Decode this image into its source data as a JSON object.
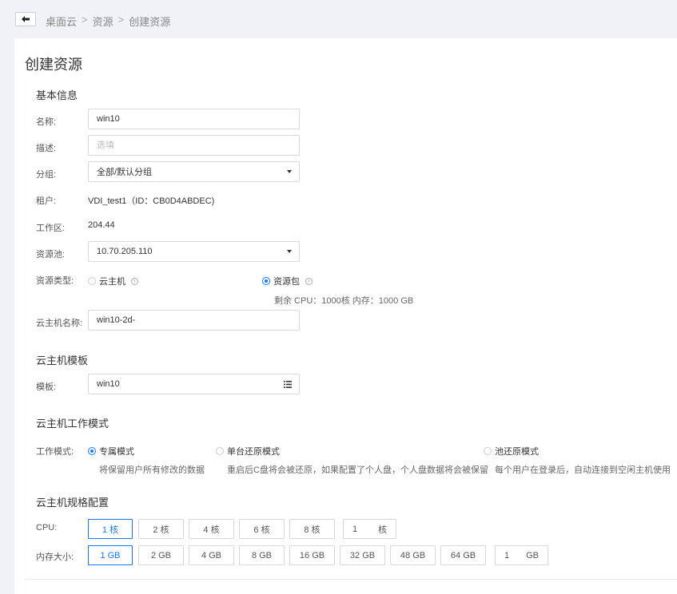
{
  "breadcrumb": {
    "items": [
      "桌面云",
      "资源",
      "创建资源"
    ],
    "separator": ">"
  },
  "page_title": "创建资源",
  "basic_info": {
    "title": "基本信息",
    "name": {
      "label": "名称:",
      "value": "win10"
    },
    "description": {
      "label": "描述:",
      "placeholder": "选填"
    },
    "group": {
      "label": "分组:",
      "value": "全部/默认分组"
    },
    "tenant": {
      "label": "租户:",
      "value": "VDI_test1（ID：CB0D4ABDEC)"
    },
    "workzone": {
      "label": "工作区:",
      "value": "204.44"
    },
    "pool": {
      "label": "资源池:",
      "value": "10.70.205.110"
    },
    "resource_type": {
      "label": "资源类型:",
      "options": [
        {
          "label": "云主机",
          "selected": false
        },
        {
          "label": "资源包",
          "selected": true
        }
      ],
      "remaining": "剩余 CPU：1000核 内存：1000 GB"
    },
    "vm_name": {
      "label": "云主机名称:",
      "value": "win10-2d-"
    }
  },
  "template": {
    "title": "云主机模板",
    "label": "模板:",
    "value": "win10"
  },
  "work_mode": {
    "title": "云主机工作模式",
    "label": "工作模式:",
    "options": [
      {
        "label": "专属模式",
        "selected": true,
        "desc": "将保留用户所有修改的数据"
      },
      {
        "label": "单台还原模式",
        "selected": false,
        "desc": "重启后C盘将会被还原，如果配置了个人盘，个人盘数据将会被保留"
      },
      {
        "label": "池还原模式",
        "selected": false,
        "desc": "每个用户在登录后，自动连接到空闲主机使用"
      }
    ]
  },
  "spec": {
    "title": "云主机规格配置",
    "cpu": {
      "label": "CPU:",
      "options": [
        "1 核",
        "2 核",
        "4 核",
        "6 核",
        "8 核"
      ],
      "selected_index": 0,
      "custom_value": "1",
      "custom_unit": "核"
    },
    "memory": {
      "label": "内存大小:",
      "options": [
        "1 GB",
        "2 GB",
        "4 GB",
        "8 GB",
        "16 GB",
        "32 GB",
        "48 GB",
        "64 GB"
      ],
      "selected_index": 0,
      "custom_value": "1",
      "custom_unit": "GB"
    }
  },
  "colors": {
    "accent": "#1677ff",
    "background": "#f0f2f5",
    "border": "#d9d9d9"
  }
}
